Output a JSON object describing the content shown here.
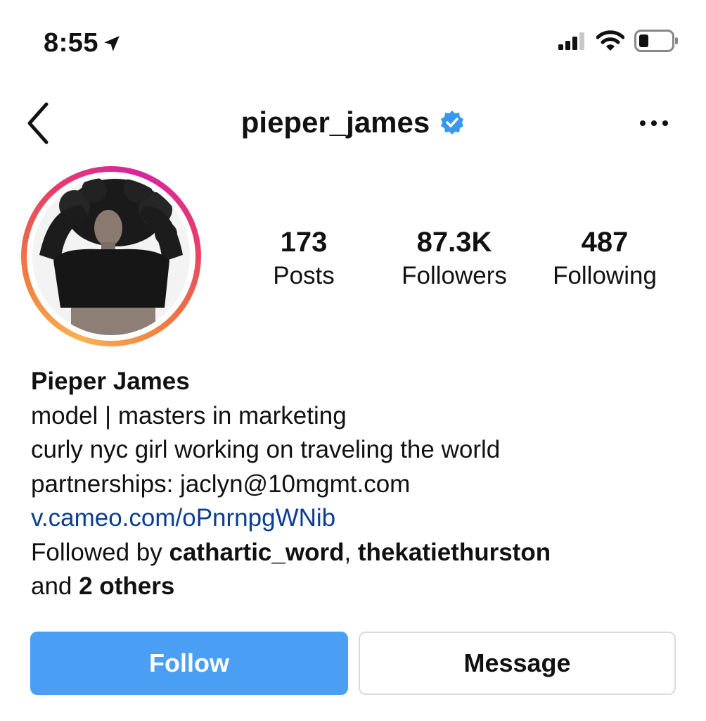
{
  "status_bar": {
    "time": "8:55",
    "location_icon": "location-arrow-icon",
    "signal_icon": "cellular-signal-icon",
    "wifi_icon": "wifi-icon",
    "battery_icon": "battery-icon"
  },
  "header": {
    "username": "pieper_james",
    "verified_icon": "verified-badge-icon",
    "back_icon": "chevron-left-icon",
    "more_icon": "more-horizontal-icon"
  },
  "stats": {
    "posts": {
      "count": "173",
      "label": "Posts"
    },
    "followers": {
      "count": "87.3K",
      "label": "Followers"
    },
    "following": {
      "count": "487",
      "label": "Following"
    }
  },
  "bio": {
    "name": "Pieper James",
    "line1": "model | masters in marketing",
    "line2": "curly nyc girl working on traveling the world",
    "line3": "partnerships: jaclyn@10mgmt.com",
    "link": "v.cameo.com/oPnrnpgWNib",
    "followed_by_prefix": "Followed by ",
    "followed_user1": "cathartic_word",
    "followed_sep": ", ",
    "followed_user2": "thekatiethurston",
    "and_prefix": "and ",
    "others": "2 others"
  },
  "actions": {
    "follow_label": "Follow",
    "message_label": "Message"
  },
  "colors": {
    "follow_button": "#4a9ff5",
    "link": "#0b3d91",
    "verified": "#3897f0"
  }
}
